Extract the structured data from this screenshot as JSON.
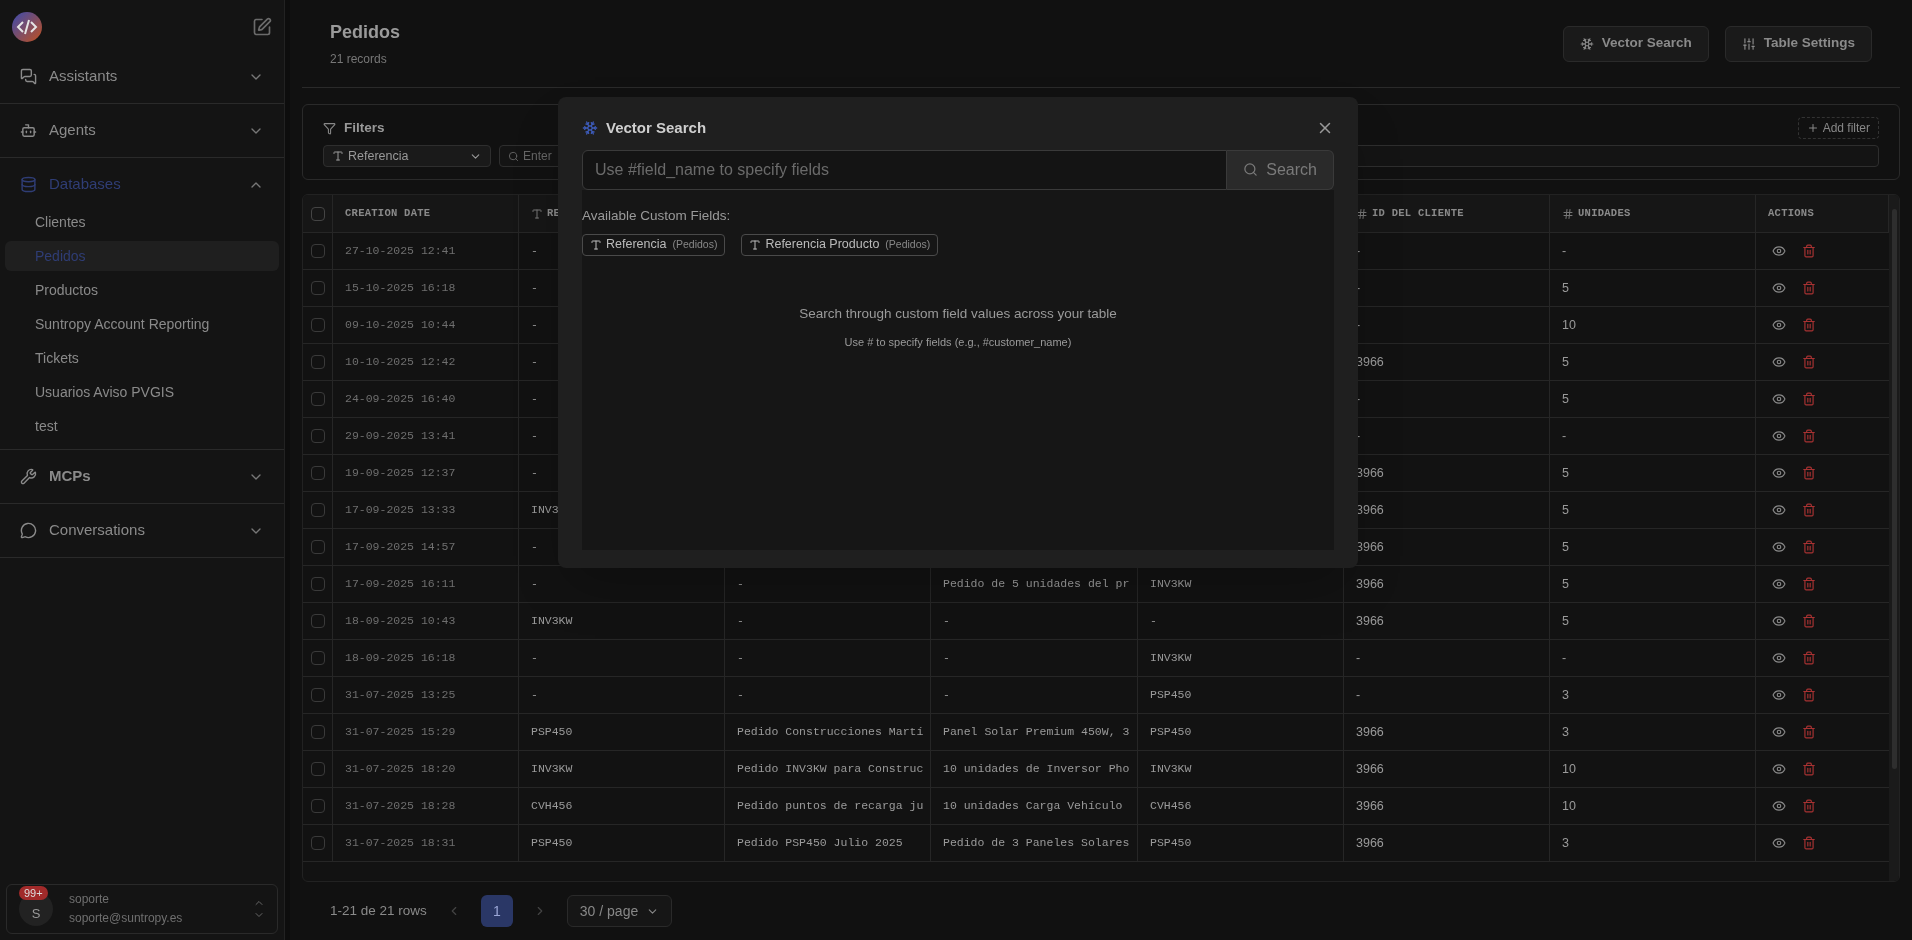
{
  "sidebar": {
    "sections": [
      {
        "label": "Assistants",
        "active": false,
        "expanded": false
      },
      {
        "label": "Agents",
        "active": false,
        "expanded": false
      },
      {
        "label": "Databases",
        "active": true,
        "expanded": true,
        "items": [
          {
            "label": "Clientes",
            "selected": false
          },
          {
            "label": "Pedidos",
            "selected": true
          },
          {
            "label": "Productos",
            "selected": false
          },
          {
            "label": "Suntropy Account Reporting",
            "selected": false
          },
          {
            "label": "Tickets",
            "selected": false
          },
          {
            "label": "Usuarios Aviso PVGIS",
            "selected": false
          },
          {
            "label": "test",
            "selected": false
          }
        ]
      },
      {
        "label": "MCPs",
        "active": false,
        "expanded": false
      },
      {
        "label": "Conversations",
        "active": false,
        "expanded": false
      }
    ],
    "user": {
      "initial": "S",
      "badge": "99+",
      "name": "soporte",
      "email": "soporte@suntropy.es"
    }
  },
  "header": {
    "title": "Pedidos",
    "subtitle": "21 records",
    "buttons": [
      {
        "label": "Vector Search",
        "kind": "vector"
      },
      {
        "label": "Table Settings",
        "kind": "settings"
      }
    ]
  },
  "filters": {
    "title": "Filters",
    "field": "Referencia",
    "placeholder": "Enter",
    "add_filter": "Add filter"
  },
  "table": {
    "all_checked": false,
    "columns": [
      {
        "label": "CREATION DATE",
        "kind": "date"
      },
      {
        "label": "RE",
        "kind": "text"
      },
      {
        "kind": "hidden"
      },
      {
        "kind": "hidden"
      },
      {
        "kind": "hidden"
      },
      {
        "label": "ID DEL CLIENTE",
        "kind": "number"
      },
      {
        "label": "UNIDADES",
        "kind": "number"
      },
      {
        "label": "ACTIONS",
        "kind": "actions"
      }
    ],
    "rows": [
      {
        "checked": false,
        "covered": true,
        "cells": [
          "27-10-2025 12:41",
          "-",
          "-",
          "-"
        ]
      },
      {
        "checked": false,
        "covered": true,
        "cells": [
          "15-10-2025 16:18",
          "-",
          "-",
          "5"
        ]
      },
      {
        "checked": false,
        "covered": true,
        "cells": [
          "09-10-2025 10:44",
          "-",
          "-",
          "10"
        ]
      },
      {
        "checked": false,
        "covered": true,
        "cells": [
          "10-10-2025 12:42",
          "-",
          "3966",
          "5"
        ]
      },
      {
        "checked": false,
        "covered": true,
        "cells": [
          "24-09-2025 16:40",
          "-",
          "-",
          "5"
        ]
      },
      {
        "checked": false,
        "covered": true,
        "cells": [
          "29-09-2025 13:41",
          "-",
          "-",
          "-"
        ]
      },
      {
        "checked": false,
        "covered": true,
        "cells": [
          "19-09-2025 12:37",
          "-",
          "3966",
          "5"
        ]
      },
      {
        "checked": false,
        "covered": true,
        "cells": [
          "17-09-2025 13:33",
          "INV3",
          "3966",
          "5"
        ]
      },
      {
        "checked": false,
        "covered": true,
        "cells": [
          "17-09-2025 14:57",
          "-",
          "3966",
          "5"
        ]
      },
      {
        "checked": false,
        "cells": [
          "17-09-2025 16:11",
          "-",
          "-",
          "Pedido de 5 unidades del pr",
          "INV3KW",
          "3966",
          "5"
        ]
      },
      {
        "checked": false,
        "cells": [
          "18-09-2025 10:43",
          "INV3KW",
          "-",
          "-",
          "-",
          "3966",
          "5"
        ]
      },
      {
        "checked": false,
        "cells": [
          "18-09-2025 16:18",
          "-",
          "-",
          "-",
          "INV3KW",
          "-",
          "-"
        ]
      },
      {
        "checked": false,
        "cells": [
          "31-07-2025 13:25",
          "-",
          "-",
          "-",
          "PSP450",
          "-",
          "3"
        ]
      },
      {
        "checked": false,
        "cells": [
          "31-07-2025 15:29",
          "PSP450",
          "Pedido Construcciones Martí",
          "Panel Solar Premium 450W, 3",
          "PSP450",
          "3966",
          "3"
        ]
      },
      {
        "checked": false,
        "cells": [
          "31-07-2025 18:20",
          "INV3KW",
          "Pedido INV3KW para Construc",
          "10 unidades de Inversor Pho",
          "INV3KW",
          "3966",
          "10"
        ]
      },
      {
        "checked": false,
        "cells": [
          "31-07-2025 18:28",
          "CVH456",
          "Pedido puntos de recarga ju",
          "10 unidades Carga Vehículo",
          "CVH456",
          "3966",
          "10"
        ]
      },
      {
        "checked": false,
        "cells": [
          "31-07-2025 18:31",
          "PSP450",
          "Pedido PSP450 Julio 2025",
          "Pedido de 3 Paneles Solares",
          "PSP450",
          "3966",
          "3"
        ]
      }
    ]
  },
  "pagination": {
    "summary": "1-21 de 21 rows",
    "pages": [
      {
        "label": "1",
        "selected": true
      }
    ],
    "page_size": "30 / page"
  },
  "modal": {
    "title": "Vector Search",
    "placeholder": "Use #field_name to specify fields",
    "search_button": "Search",
    "fields_label": "Available Custom Fields:",
    "fields": [
      {
        "name": "Referencia",
        "table": "(Pedidos)"
      },
      {
        "name": "Referencia Producto",
        "table": "(Pedidos)"
      }
    ],
    "hint": "Search through custom field values across your table",
    "hint_sub": "Use # to specify fields (e.g., #customer_name)"
  }
}
